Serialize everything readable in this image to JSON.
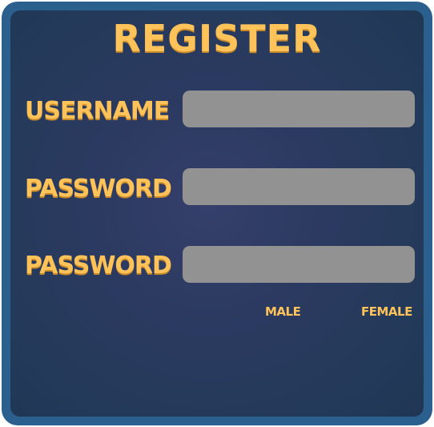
{
  "form": {
    "title": "REGISTER",
    "fields": [
      {
        "label": "USERNAME",
        "value": "",
        "placeholder": ""
      },
      {
        "label": "PASSWORD",
        "value": "",
        "placeholder": ""
      },
      {
        "label": "PASSWORD",
        "value": "",
        "placeholder": ""
      }
    ],
    "gender_options": [
      "MALE",
      "FEMALE"
    ]
  },
  "colors": {
    "frame": "#2a5f8e",
    "panel": "#2b3a60",
    "label_text": "#ffc35a",
    "field_background": "#929292"
  }
}
